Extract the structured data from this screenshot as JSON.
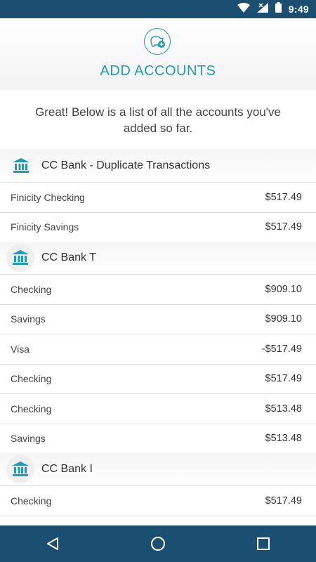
{
  "status_bar": {
    "time": "9:49"
  },
  "header": {
    "title": "ADD ACCOUNTS",
    "logo_icon": "piggy-bank-add-icon",
    "accent_color": "#1f9bb3"
  },
  "intro": {
    "text": "Great! Below is a list of all the accounts you've added so far."
  },
  "banks": [
    {
      "name": "CC Bank - Duplicate Transactions",
      "accounts": [
        {
          "name": "Finicity Checking",
          "amount": "$517.49"
        },
        {
          "name": "Finicity Savings",
          "amount": "$517.49"
        }
      ]
    },
    {
      "name": "CC Bank T",
      "accounts": [
        {
          "name": "Checking",
          "amount": "$909.10"
        },
        {
          "name": "Savings",
          "amount": "$909.10"
        },
        {
          "name": "Visa",
          "amount": "-$517.49"
        },
        {
          "name": "Checking",
          "amount": "$517.49"
        },
        {
          "name": "Checking",
          "amount": "$513.48"
        },
        {
          "name": "Savings",
          "amount": "$513.48"
        }
      ]
    },
    {
      "name": "CC Bank I",
      "accounts": [
        {
          "name": "Checking",
          "amount": "$517.49"
        }
      ]
    }
  ],
  "nav": {
    "back_icon": "back-triangle-icon",
    "home_icon": "home-circle-icon",
    "recents_icon": "recents-square-icon"
  }
}
